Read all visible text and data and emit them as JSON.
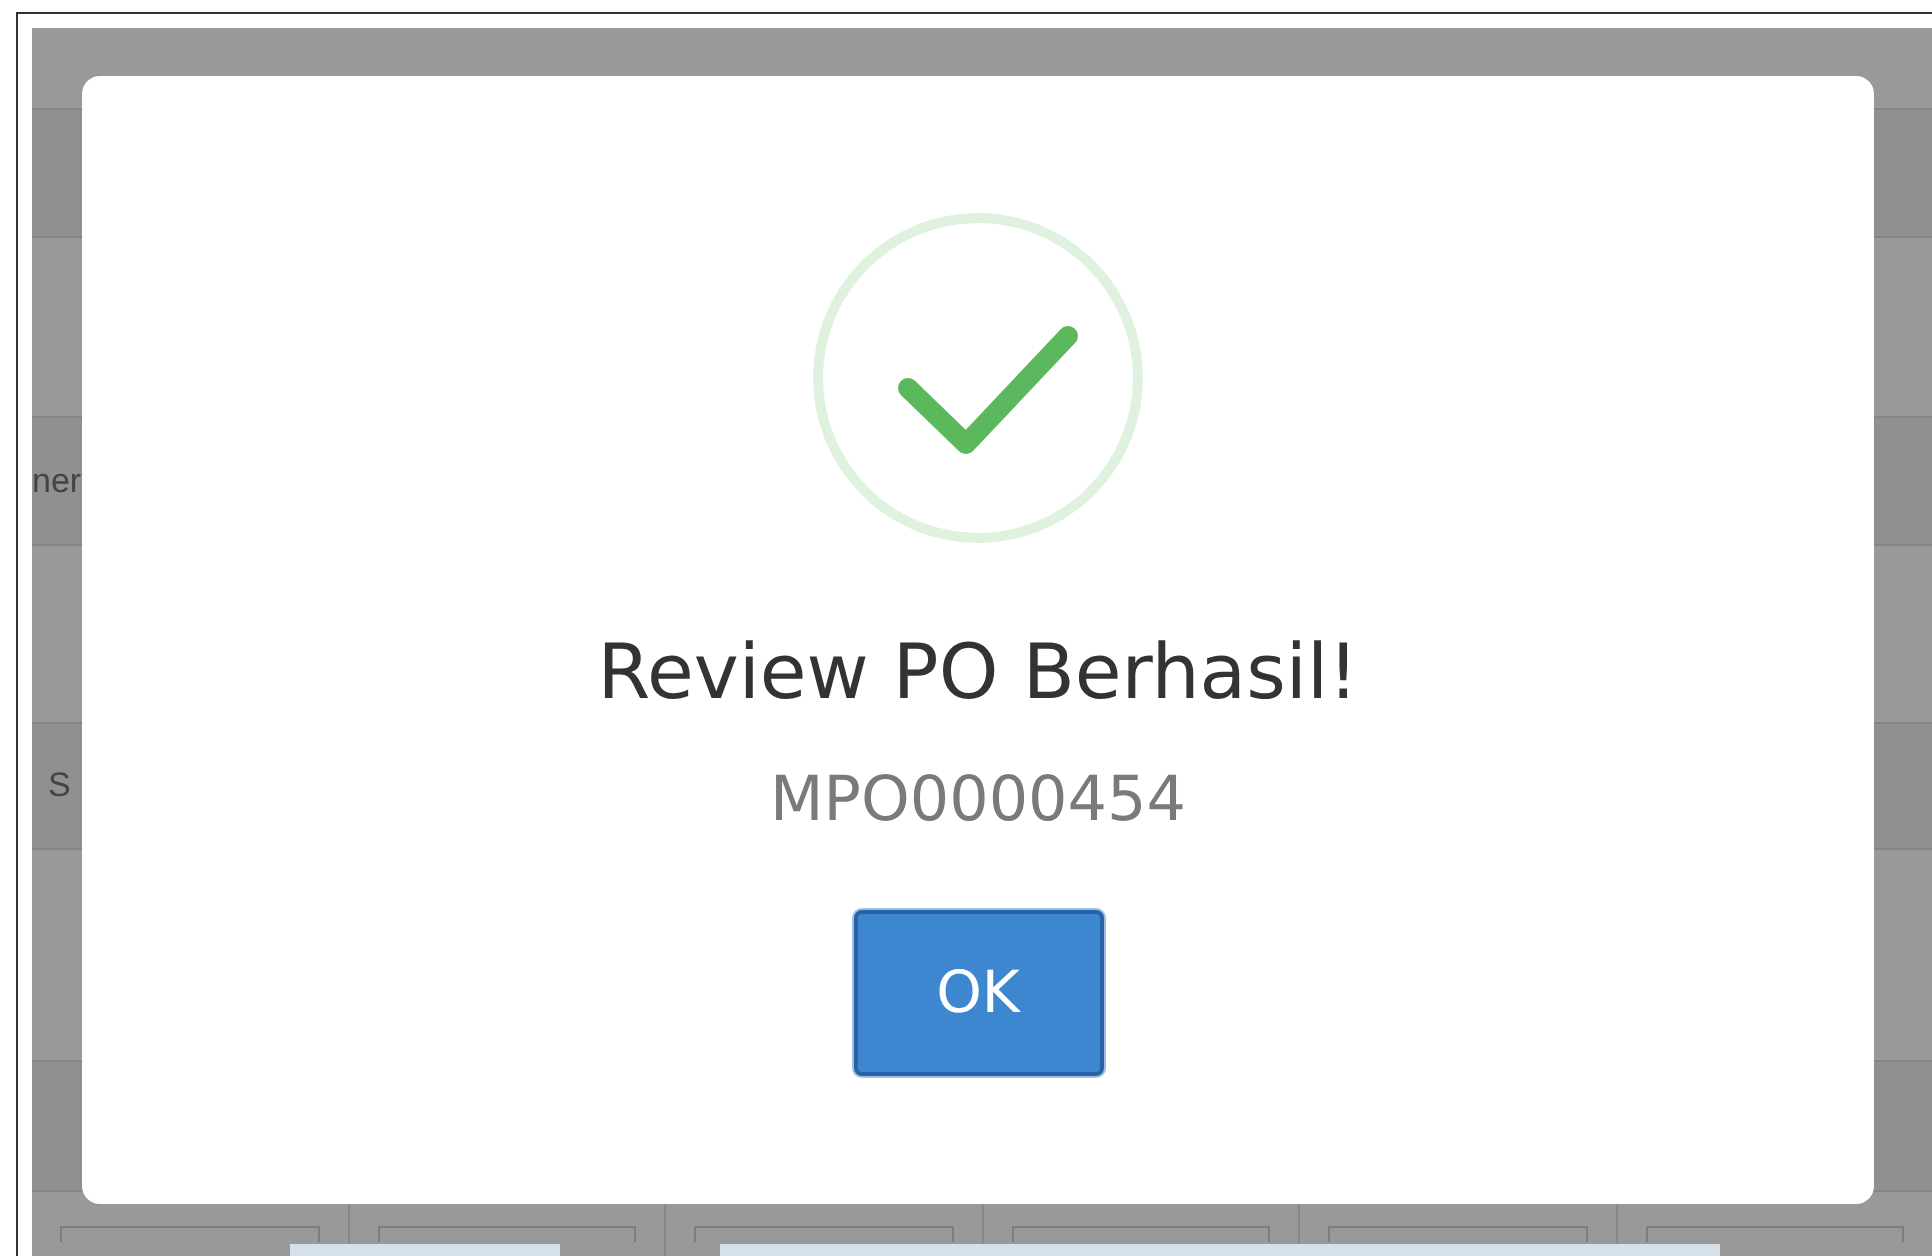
{
  "background_table": {
    "row_fragments": [
      {
        "text": "ner"
      },
      {
        "text": "S"
      }
    ]
  },
  "dialog": {
    "title": "Review PO Berhasil!",
    "reference": "MPO0000454",
    "button": "OK"
  }
}
